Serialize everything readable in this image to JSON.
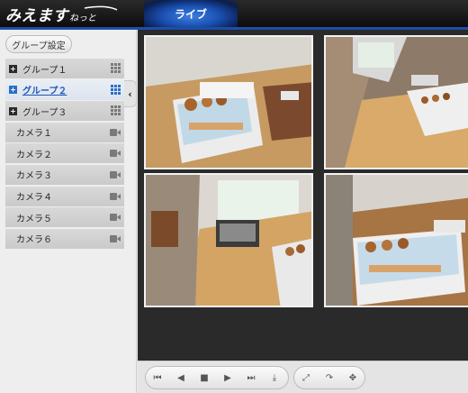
{
  "header": {
    "logo_main": "みえます",
    "logo_sub": "ねっと",
    "nav_tab": "ライブ"
  },
  "sidebar": {
    "group_setting_label": "グループ設定",
    "collapse_glyph": "‹",
    "groups": [
      {
        "label": "グループ１",
        "active": false
      },
      {
        "label": "グループ２",
        "active": true
      },
      {
        "label": "グループ３",
        "active": false
      }
    ],
    "cameras": [
      {
        "label": "カメラ１"
      },
      {
        "label": "カメラ２"
      },
      {
        "label": "カメラ３"
      },
      {
        "label": "カメラ４"
      },
      {
        "label": "カメラ５"
      },
      {
        "label": "カメラ６"
      }
    ]
  },
  "controls": {
    "playback": [
      {
        "name": "skip-to-start-icon",
        "glyph": "⏮"
      },
      {
        "name": "step-back-icon",
        "glyph": "◀"
      },
      {
        "name": "stop-icon",
        "glyph": "■"
      },
      {
        "name": "play-icon",
        "glyph": "▶"
      },
      {
        "name": "skip-to-end-icon",
        "glyph": "⏭"
      },
      {
        "name": "download-icon",
        "glyph": "⤓"
      }
    ],
    "view": [
      {
        "name": "fullscreen-icon",
        "glyph": "⤢"
      },
      {
        "name": "rotate-icon",
        "glyph": "↷"
      },
      {
        "name": "move-icon",
        "glyph": "✥"
      }
    ]
  },
  "colors": {
    "accent": "#1c4ea8",
    "active_text": "#1d57b8"
  }
}
